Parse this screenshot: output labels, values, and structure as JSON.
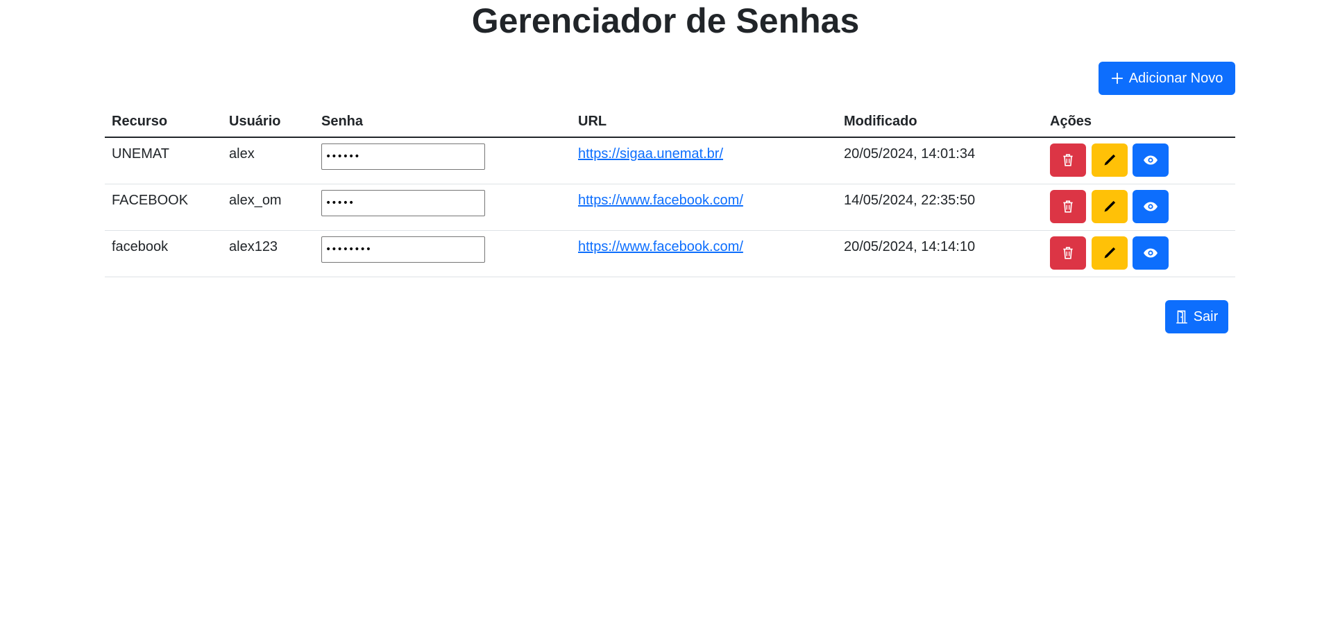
{
  "page_title": "Gerenciador de Senhas",
  "add_button": {
    "label": "Adicionar Novo",
    "icon": "plus-icon"
  },
  "exit_button": {
    "label": "Sair",
    "icon": "door-icon"
  },
  "table": {
    "headers": [
      "Recurso",
      "Usuário",
      "Senha",
      "URL",
      "Modificado",
      "Ações"
    ],
    "rows": [
      {
        "resource": "UNEMAT",
        "user": "alex",
        "password_masked": "••••••",
        "url": "https://sigaa.unemat.br/",
        "modified": "20/05/2024, 14:01:34"
      },
      {
        "resource": "FACEBOOK",
        "user": "alex_om",
        "password_masked": "•••••",
        "url": "https://www.facebook.com/",
        "modified": "14/05/2024, 22:35:50"
      },
      {
        "resource": "facebook",
        "user": "alex123",
        "password_masked": "••••••••",
        "url": "https://www.facebook.com/",
        "modified": "20/05/2024, 14:14:10"
      }
    ]
  },
  "colors": {
    "primary": "#0d6efd",
    "danger": "#dc3545",
    "warning": "#ffc107"
  }
}
